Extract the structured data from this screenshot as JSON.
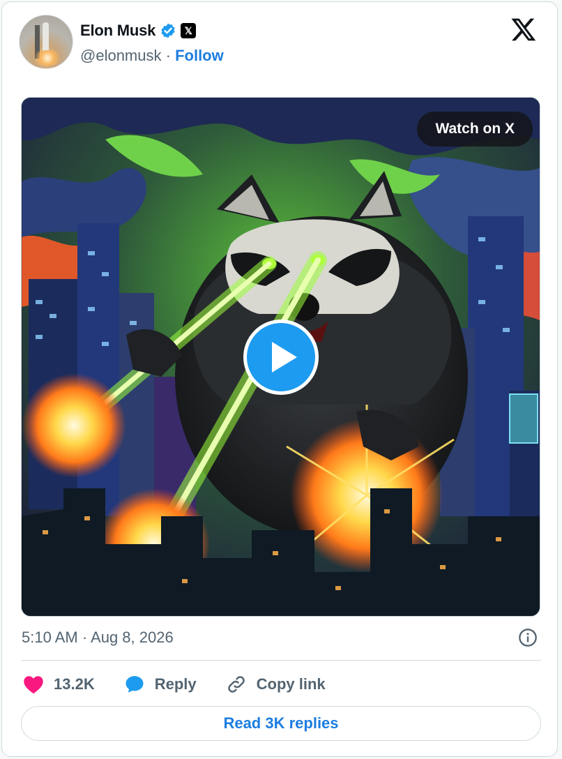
{
  "author": {
    "name": "Elon Musk",
    "handle": "@elonmusk",
    "separator": "·",
    "follow_label": "Follow",
    "badge_letter": "𝕏"
  },
  "media": {
    "watch_label": "Watch on X",
    "icons": [
      "play-icon"
    ]
  },
  "tweet": {
    "timestamp": "5:10 AM · Aug 8, 2026"
  },
  "actions": {
    "likes_count": "13.2K",
    "reply_label": "Reply",
    "copy_link_label": "Copy link"
  },
  "footer": {
    "read_replies_label": "Read 3K replies"
  },
  "colors": {
    "accent": "#1d9bf0",
    "link": "#1d7ddf",
    "like": "#f91880",
    "muted": "#536471"
  }
}
